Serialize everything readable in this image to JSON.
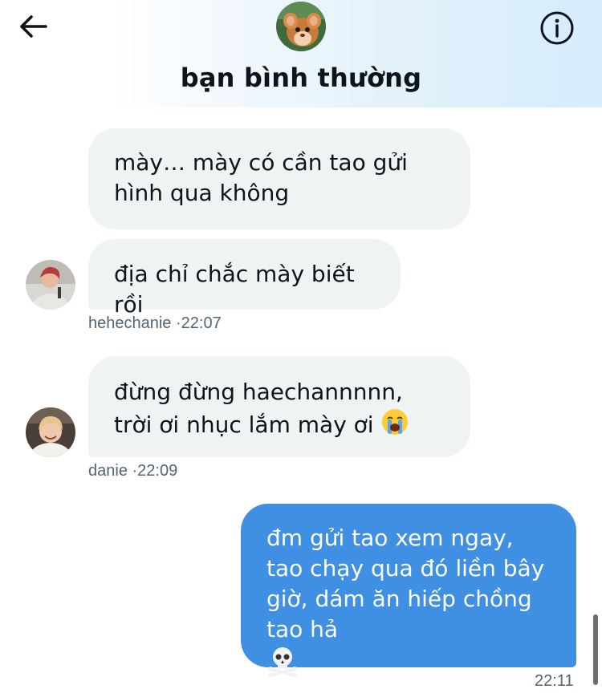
{
  "header": {
    "title": "bạn bình thường",
    "back_icon": "arrow-left-icon",
    "info_icon": "info-circle-icon"
  },
  "messages": [
    {
      "text": "mày… mày có cần tao gửi hình qua không",
      "direction": "incoming"
    },
    {
      "text": "địa chỉ chắc mày biết rồi",
      "direction": "incoming",
      "sender": "hehechanie",
      "time": "·22:07"
    },
    {
      "text": "đừng đừng haechannnnn, trời ơi nhục lắm mày ơi",
      "emoji": "crying-face",
      "direction": "incoming",
      "sender": "danie",
      "time": "·22:09"
    },
    {
      "text": "đm gửi tao xem ngay, tao chạy qua đó liền bây giờ, dám ăn hiếp chồng tao hả",
      "emoji": "skull-crossbones",
      "direction": "outgoing",
      "time": "22:11"
    }
  ],
  "colors": {
    "incoming_bubble": "#eff3f4",
    "outgoing_bubble": "#3f8fe3",
    "meta_text": "#536471"
  }
}
